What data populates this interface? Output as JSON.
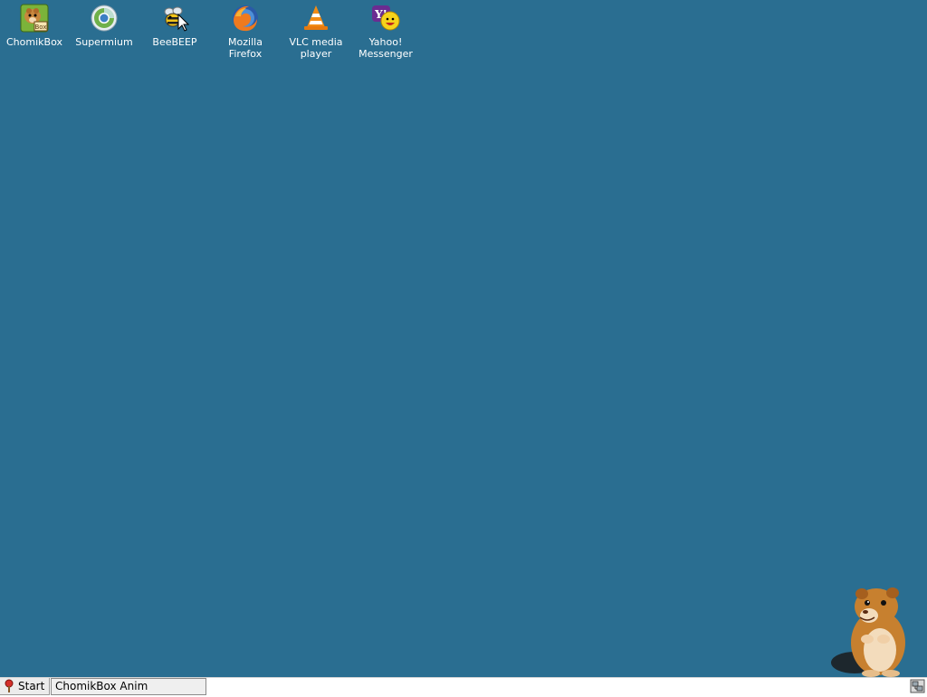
{
  "desktop": {
    "background_color": "#2a6e91",
    "icons": [
      {
        "id": "chomikbox",
        "label": "ChomikBox",
        "icon": "chomikbox-icon"
      },
      {
        "id": "supermium",
        "label": "Supermium",
        "icon": "supermium-icon"
      },
      {
        "id": "beebeep",
        "label": "BeeBEEP",
        "icon": "beebeep-icon"
      },
      {
        "id": "firefox",
        "label": "Mozilla Firefox",
        "icon": "firefox-icon"
      },
      {
        "id": "vlc",
        "label": "VLC media player",
        "icon": "vlc-icon"
      },
      {
        "id": "yahoo",
        "label": "Yahoo! Messenger",
        "icon": "yahoo-messenger-icon"
      }
    ],
    "mascot": {
      "icon": "hamster-mascot-icon"
    }
  },
  "taskbar": {
    "start_label": "Start",
    "tasks": [
      {
        "label": "ChomikBox Anim"
      }
    ],
    "tray_icon": "tray-network-icon"
  }
}
